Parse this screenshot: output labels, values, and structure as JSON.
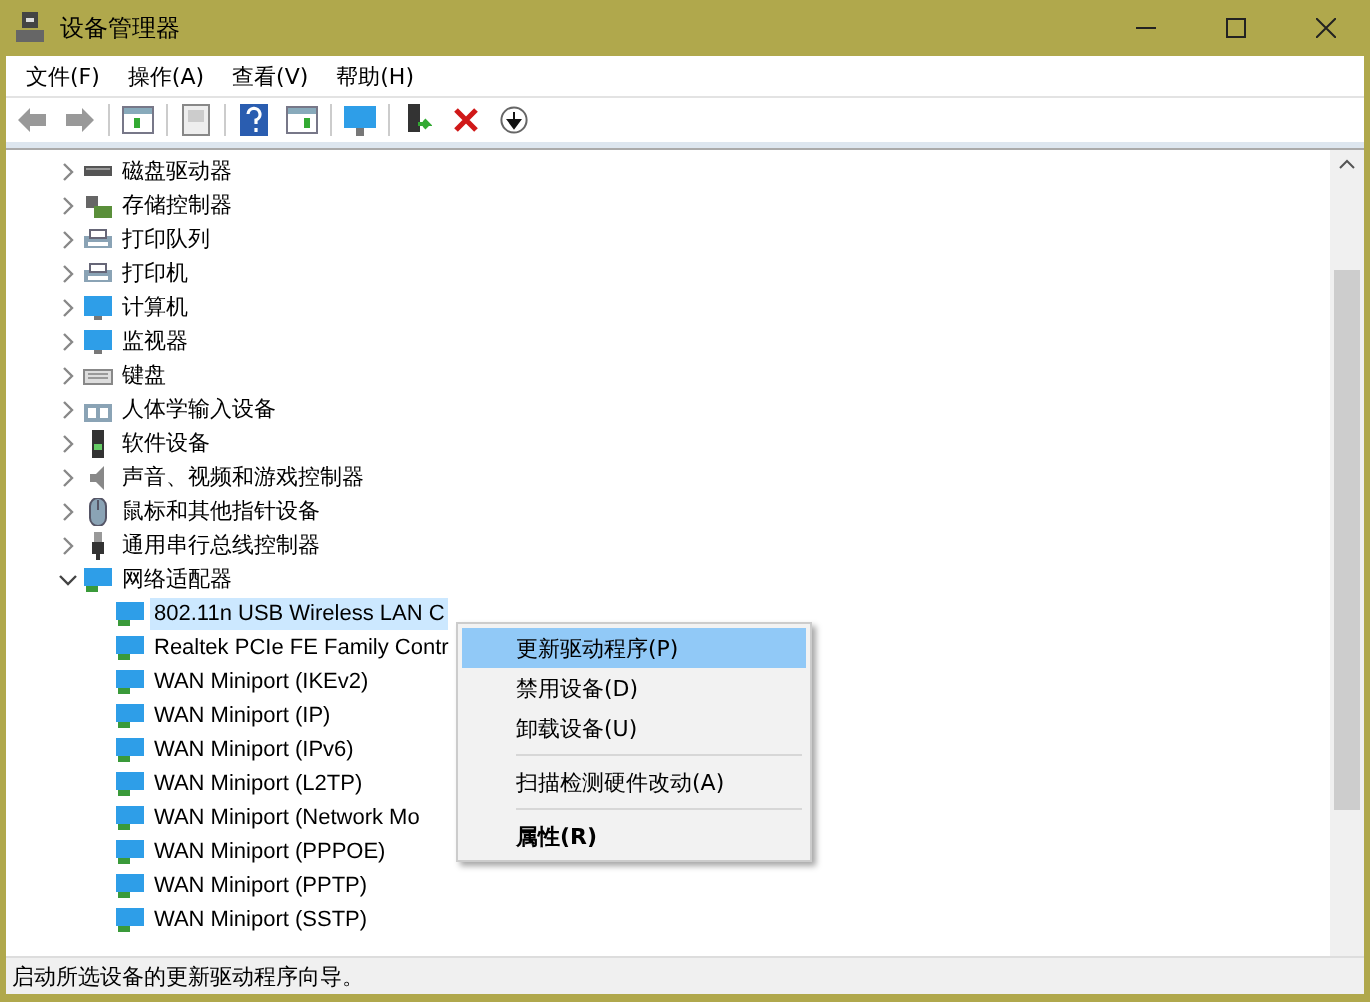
{
  "window": {
    "title": "设备管理器"
  },
  "menu": [
    "文件(F)",
    "操作(A)",
    "查看(V)",
    "帮助(H)"
  ],
  "tree": [
    {
      "label": "磁盘驱动器",
      "kind": "disk",
      "expanded": false
    },
    {
      "label": "存储控制器",
      "kind": "storage",
      "expanded": false
    },
    {
      "label": "打印队列",
      "kind": "printer",
      "expanded": false
    },
    {
      "label": "打印机",
      "kind": "printer",
      "expanded": false
    },
    {
      "label": "计算机",
      "kind": "monitor",
      "expanded": false
    },
    {
      "label": "监视器",
      "kind": "monitor",
      "expanded": false
    },
    {
      "label": "键盘",
      "kind": "keyboard",
      "expanded": false
    },
    {
      "label": "人体学输入设备",
      "kind": "hid",
      "expanded": false
    },
    {
      "label": "软件设备",
      "kind": "software",
      "expanded": false
    },
    {
      "label": "声音、视频和游戏控制器",
      "kind": "sound",
      "expanded": false
    },
    {
      "label": "鼠标和其他指针设备",
      "kind": "mouse",
      "expanded": false
    },
    {
      "label": "通用串行总线控制器",
      "kind": "usb",
      "expanded": false
    },
    {
      "label": "网络适配器",
      "kind": "network",
      "expanded": true,
      "children": [
        {
          "label": "802.11n USB Wireless LAN C",
          "kind": "network",
          "selected": true
        },
        {
          "label": "Realtek PCIe FE Family Contr",
          "kind": "network",
          "selected": false
        },
        {
          "label": "WAN Miniport (IKEv2)",
          "kind": "network",
          "selected": false
        },
        {
          "label": "WAN Miniport (IP)",
          "kind": "network",
          "selected": false
        },
        {
          "label": "WAN Miniport (IPv6)",
          "kind": "network",
          "selected": false
        },
        {
          "label": "WAN Miniport (L2TP)",
          "kind": "network",
          "selected": false
        },
        {
          "label": "WAN Miniport (Network Mo",
          "kind": "network",
          "selected": false
        },
        {
          "label": "WAN Miniport (PPPOE)",
          "kind": "network",
          "selected": false
        },
        {
          "label": "WAN Miniport (PPTP)",
          "kind": "network",
          "selected": false
        },
        {
          "label": "WAN Miniport (SSTP)",
          "kind": "network",
          "selected": false
        }
      ]
    }
  ],
  "context_menu": [
    {
      "kind": "item",
      "label": "更新驱动程序(P)",
      "selected": true
    },
    {
      "kind": "item",
      "label": "禁用设备(D)",
      "selected": false
    },
    {
      "kind": "item",
      "label": "卸载设备(U)",
      "selected": false
    },
    {
      "kind": "separator"
    },
    {
      "kind": "item",
      "label": "扫描检测硬件改动(A)",
      "selected": false
    },
    {
      "kind": "separator"
    },
    {
      "kind": "default",
      "label": "属性(R)",
      "selected": false
    }
  ],
  "status_bar": "启动所选设备的更新驱动程序向导。"
}
